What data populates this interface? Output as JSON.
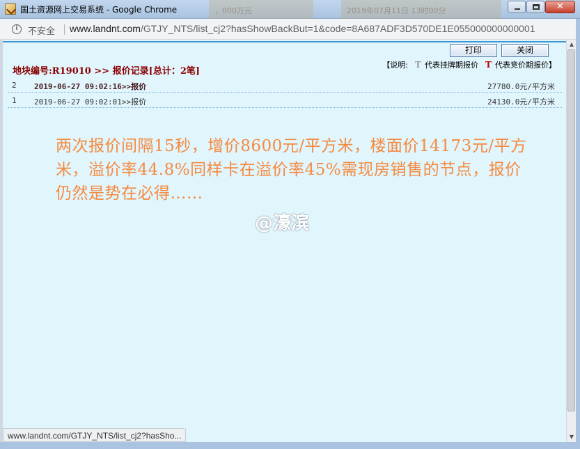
{
  "window": {
    "title": "国土资源网上交易系统 - Google Chrome",
    "background_tabs": [
      "，000万元",
      "2019年07月11日 13时00分"
    ]
  },
  "address": {
    "security_label": "不安全",
    "url_host": "www.landnt.com",
    "url_path": "/GTJY_NTS/list_cj2?hasShowBackBut=1&code=8A687ADF3D570DE1E055000000000001"
  },
  "toolbar": {
    "print_label": "打印",
    "close_label": "关闭"
  },
  "header": {
    "title": "地块编号:R19010 >> 报价记录[总计：2笔]"
  },
  "legend": {
    "prefix": "【说明:",
    "listing_icon": "T",
    "listing_label": "代表挂牌期报价",
    "auction_icon": "T",
    "auction_label": "代表竞价期报价】"
  },
  "records": [
    {
      "no": "2",
      "time": "2019-06-27 09:02:16>>报价",
      "price": "27780.0元/平方米"
    },
    {
      "no": "1",
      "time": "2019-06-27 09:02:01>>报价",
      "price": "24130.0元/平方米"
    }
  ],
  "annotation": {
    "text": "两次报价间隔15秒，增价8600元/平方米，楼面价14173元/平方米，溢价率44.8%同样卡在溢价率45%需现房销售的节点，报价仍然是势在必得……",
    "watermark": "@濠滨"
  },
  "status": {
    "hover_url": "www.landnt.com/GTJY_NTS/list_cj2?hasSho..."
  },
  "colors": {
    "page_bg": "#e1f5fd",
    "heading": "#8b0000",
    "annotation": "#f58a3f",
    "accent_line": "#3f96d2"
  }
}
